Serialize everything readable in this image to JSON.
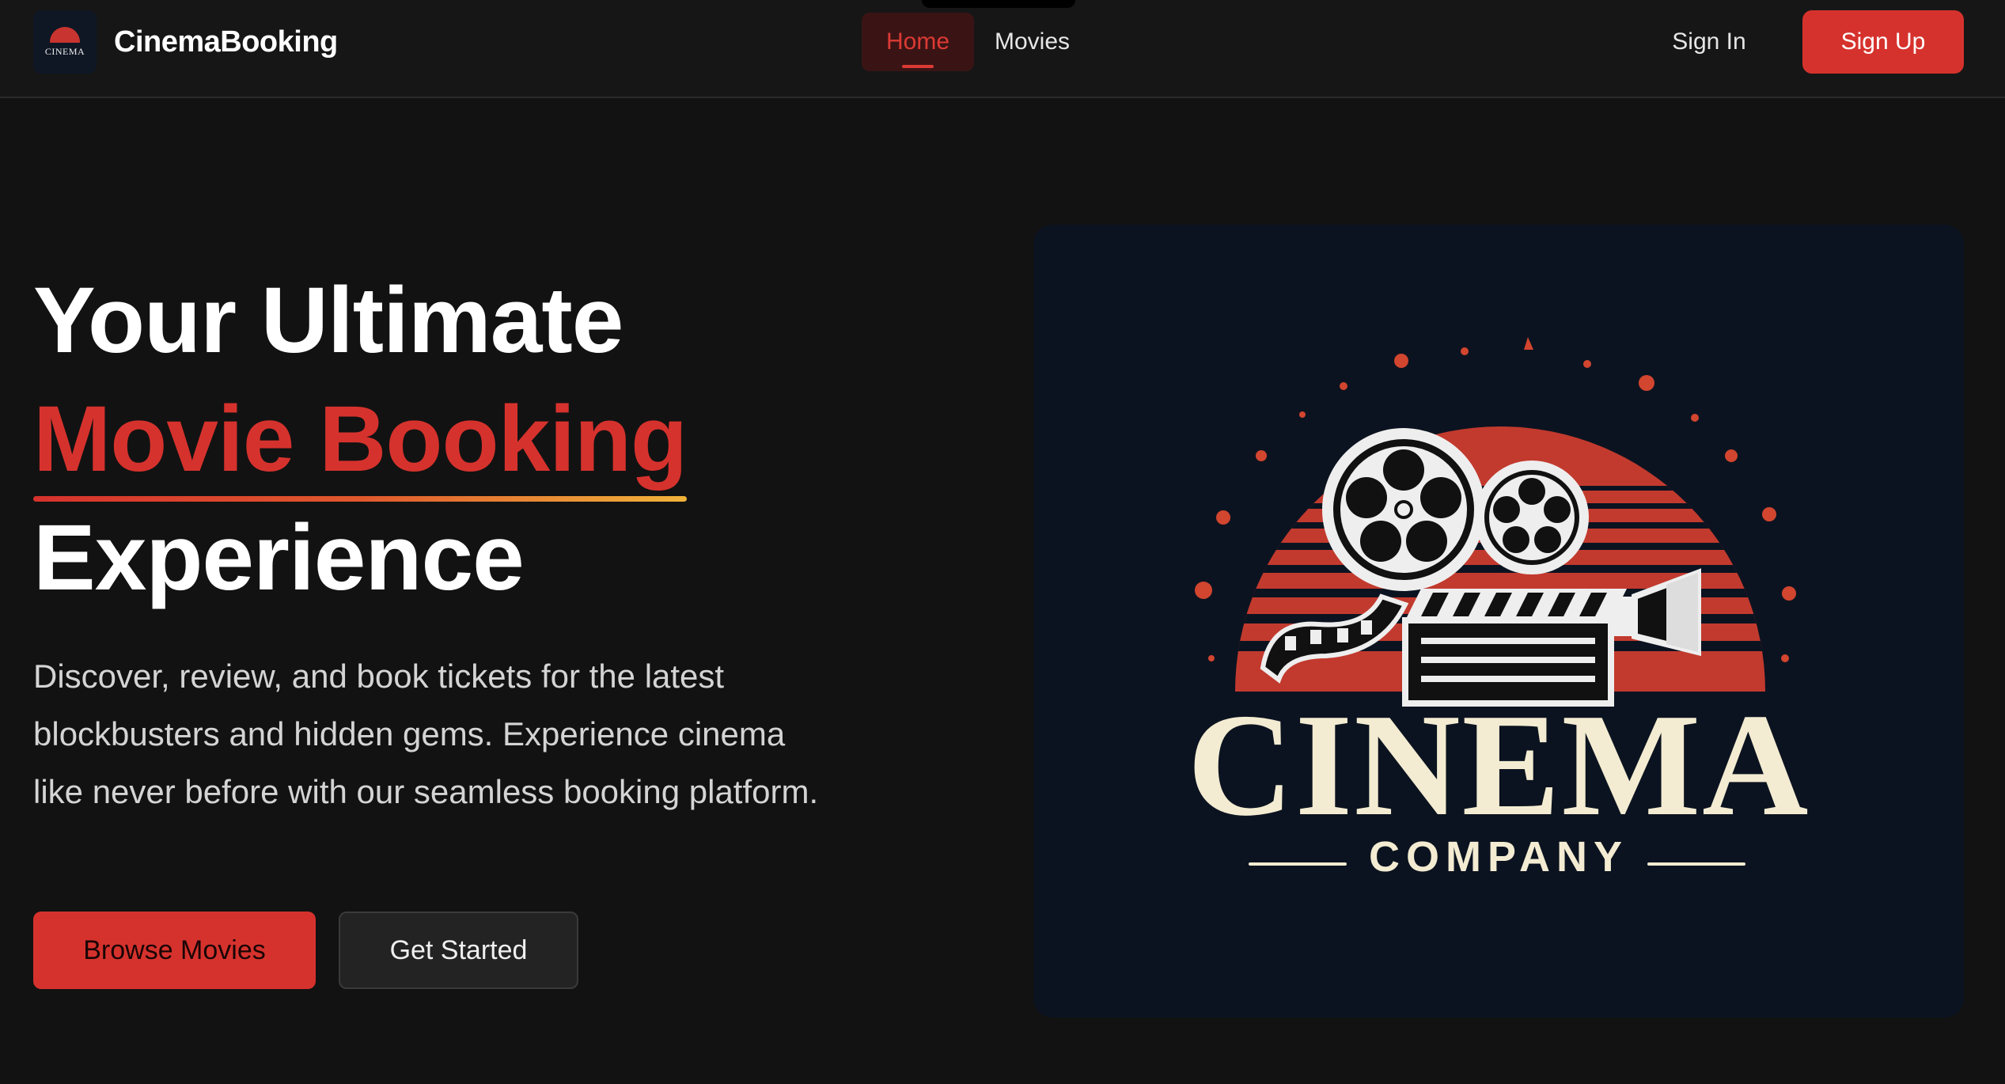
{
  "header": {
    "brand_logo_text": "CINEMA",
    "brand_name": "CinemaBooking",
    "nav": {
      "home": "Home",
      "movies": "Movies"
    },
    "sign_in": "Sign In",
    "sign_up": "Sign Up"
  },
  "hero": {
    "title_line1": "Your Ultimate",
    "title_line2": "Movie Booking",
    "title_line3": "Experience",
    "description": "Discover, review, and book tickets for the latest blockbusters and hidden gems. Experience cinema like never before with our seamless booking platform.",
    "browse_button": "Browse Movies",
    "start_button": "Get Started"
  },
  "poster": {
    "title": "CINEMA",
    "subtitle": "COMPANY"
  },
  "colors": {
    "accent": "#d6322d",
    "background": "#121212",
    "poster_bg": "#0c1320",
    "poster_text": "#f3ecd2"
  }
}
